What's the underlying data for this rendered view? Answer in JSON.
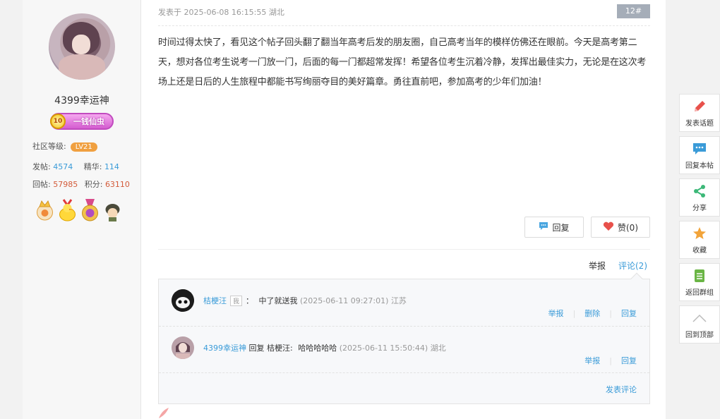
{
  "user": {
    "name": "4399幸运神",
    "title_badge": {
      "level": "10",
      "text": "一钱仙虫"
    },
    "community_level_label": "社区等级:",
    "community_level_value": "LV21",
    "stats": {
      "posts_label": "发帖:",
      "posts_value": "4574",
      "featured_label": "精华:",
      "featured_value": "114",
      "replies_label": "回帖:",
      "replies_value": "57985",
      "points_label": "积分:",
      "points_value": "63110"
    },
    "medals": [
      "crown-medal-icon",
      "duck-medal-icon",
      "gold-ribbon-medal-icon",
      "soldier-medal-icon"
    ]
  },
  "post": {
    "meta": "发表于 2025-06-08 16:15:55 湖北",
    "floor": "12#",
    "content": "时间过得太快了，看见这个帖子回头翻了翻当年高考后发的朋友圈，自己高考当年的模样仿佛还在眼前。今天是高考第二天，想对各位考生说考一门放一门，后面的每一门都超常发挥！希望各位考生沉着冷静，发挥出最佳实力，无论是在这次考场上还是日后的人生旅程中都能书写绚丽夺目的美好篇章。勇往直前吧，参加高考的少年们加油！",
    "reply_button": "回复",
    "like_button": "赞(0)",
    "report_link": "举报",
    "comments_link": "评论(2)"
  },
  "comments": {
    "items": [
      {
        "author": "桔梗汪",
        "tag": "我",
        "separator": "：",
        "text": "中了就送我",
        "time": "(2025-06-11 09:27:01)",
        "location": "江苏",
        "actions": [
          "举报",
          "删除",
          "回复"
        ]
      },
      {
        "author": "4399幸运神",
        "reply_word": "回复",
        "reply_to": "桔梗汪:",
        "text": "哈哈哈哈哈",
        "time": "(2025-06-11 15:50:44)",
        "location": "湖北",
        "actions": [
          "举报",
          "回复"
        ]
      }
    ],
    "post_comment_link": "发表评论"
  },
  "toolbar": {
    "items": [
      {
        "label": "发表话题",
        "icon": "pencil-icon",
        "color": "#e8514b"
      },
      {
        "label": "回复本帖",
        "icon": "chat-bubble-icon",
        "color": "#3a9bd8"
      },
      {
        "label": "分享",
        "icon": "share-icon",
        "color": "#3cb878"
      },
      {
        "label": "收藏",
        "icon": "star-icon",
        "color": "#f2a43a"
      },
      {
        "label": "返回群组",
        "icon": "document-icon",
        "color": "#6ab545"
      },
      {
        "label": "回到顶部",
        "icon": "chevron-up-icon",
        "color": "#bbbbbb"
      }
    ]
  }
}
